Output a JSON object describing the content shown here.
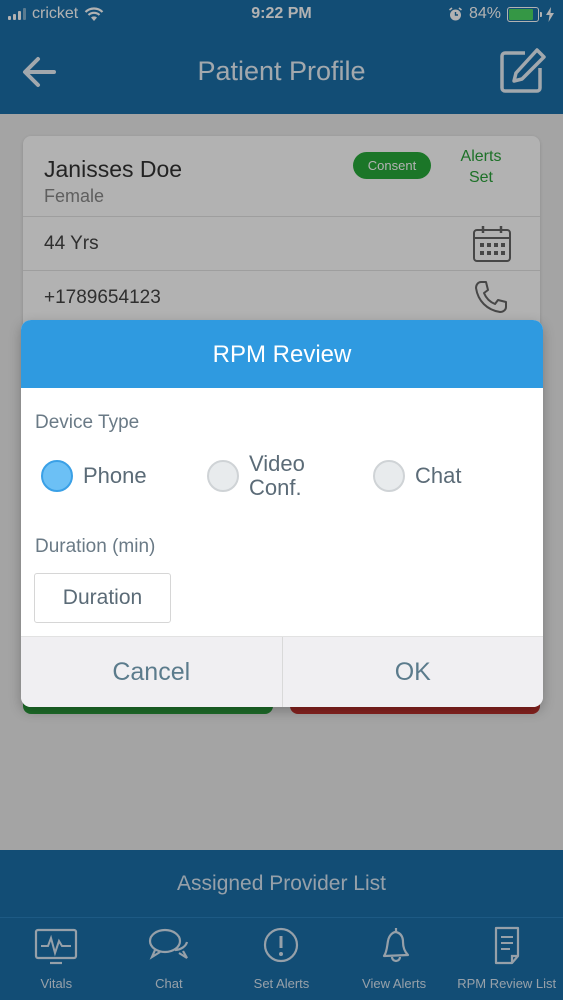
{
  "status_bar": {
    "carrier": "cricket",
    "time": "9:22 PM",
    "battery_percent": "84%",
    "battery_level": 0.84
  },
  "header": {
    "title": "Patient Profile"
  },
  "patient": {
    "name": "Janisses Doe",
    "gender": "Female",
    "consent_badge": "Consent",
    "alerts_line1": "Alerts",
    "alerts_line2": "Set",
    "age": "44 Yrs",
    "phone": "+1789654123"
  },
  "modal": {
    "title": "RPM Review",
    "device_type_label": "Device Type",
    "options": [
      {
        "label": "Phone",
        "selected": true
      },
      {
        "label_line1": "Video",
        "label_line2": "Conf.",
        "selected": false
      },
      {
        "label": "Chat",
        "selected": false
      }
    ],
    "duration_label": "Duration (min)",
    "duration_placeholder": "Duration",
    "cancel_label": "Cancel",
    "ok_label": "OK"
  },
  "provider_bar": {
    "label": "Assigned Provider List"
  },
  "tabs": [
    {
      "label": "Vitals",
      "icon": "vitals-icon"
    },
    {
      "label": "Chat",
      "icon": "chat-bubbles-icon"
    },
    {
      "label": "Set Alerts",
      "icon": "exclamation-icon"
    },
    {
      "label": "View Alerts",
      "icon": "bell-icon"
    },
    {
      "label": "RPM Review List",
      "icon": "document-icon"
    }
  ],
  "colors": {
    "primary_blue": "#1b6fa8",
    "modal_header_blue": "#2f9ae0",
    "consent_green": "#27a93a",
    "selected_radio": "#6cc0f5"
  }
}
